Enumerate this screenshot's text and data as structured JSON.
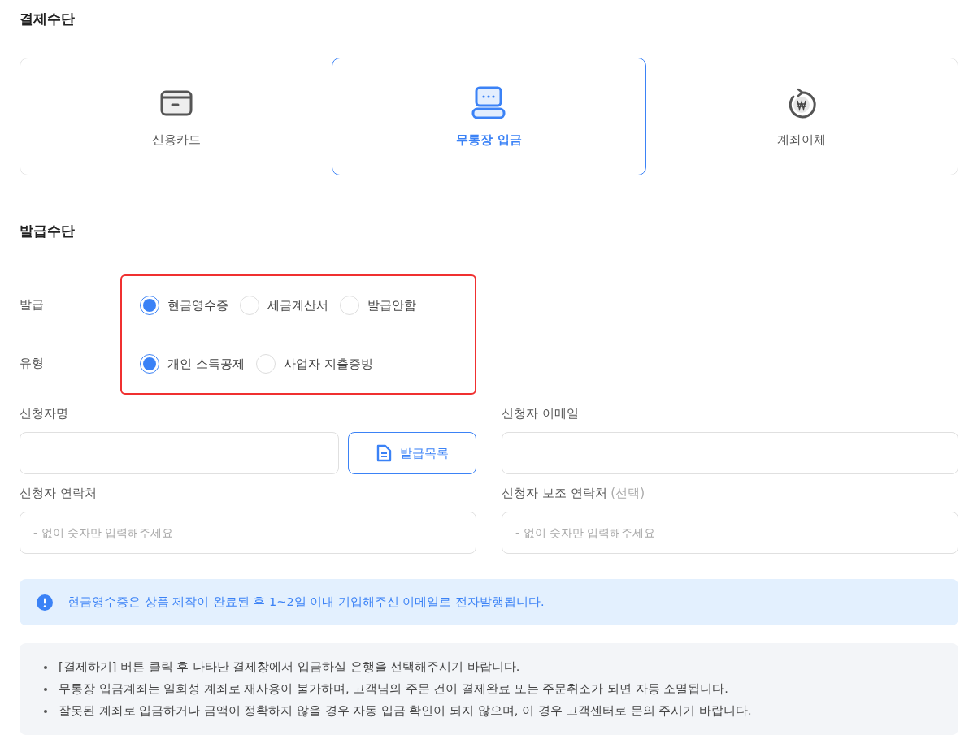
{
  "payment_section": {
    "title": "결제수단",
    "methods": [
      {
        "kind": "card",
        "label": "신용카드",
        "selected": false
      },
      {
        "kind": "deposit",
        "label": "무통장 입금",
        "selected": true
      },
      {
        "kind": "transfer",
        "label": "계좌이체",
        "selected": false
      }
    ]
  },
  "issuance_section": {
    "title": "발급수단",
    "highlighted": true,
    "rows": [
      {
        "label": "발급",
        "options": [
          {
            "label": "현금영수증",
            "selected": true
          },
          {
            "label": "세금계산서",
            "selected": false
          },
          {
            "label": "발급안함",
            "selected": false
          }
        ]
      },
      {
        "label": "유형",
        "options": [
          {
            "label": "개인 소득공제",
            "selected": true
          },
          {
            "label": "사업자 지출증빙",
            "selected": false
          }
        ]
      }
    ]
  },
  "fields": [
    {
      "label": "신청자명",
      "button": "발급목록"
    },
    {
      "label": "신청자 이메일"
    },
    {
      "label": "신청자 연락처",
      "placeholder": "- 없이 숫자만 입력해주세요"
    },
    {
      "label": "신청자 보조 연락처",
      "optional_note": "(선택)",
      "placeholder": "- 없이 숫자만 입력해주세요"
    }
  ],
  "info": "현금영수증은 상품 제작이 완료된 후 1~2일 이내 기입해주신 이메일로 전자발행됩니다.",
  "notices": [
    "[결제하기] 버튼 클릭 후 나타난 결제창에서 입금하실 은행을 선택해주시기 바랍니다.",
    "무통장 입금계좌는 일회성 계좌로 재사용이 불가하며, 고객님의 주문 건이 결제완료 또는 주문취소가 되면 자동 소멸됩니다.",
    "잘못된 계좌로 입금하거나 금액이 정확하지 않을 경우 자동 입금 확인이 되지 않으며, 이 경우 고객센터로 문의 주시기 바랍니다."
  ]
}
